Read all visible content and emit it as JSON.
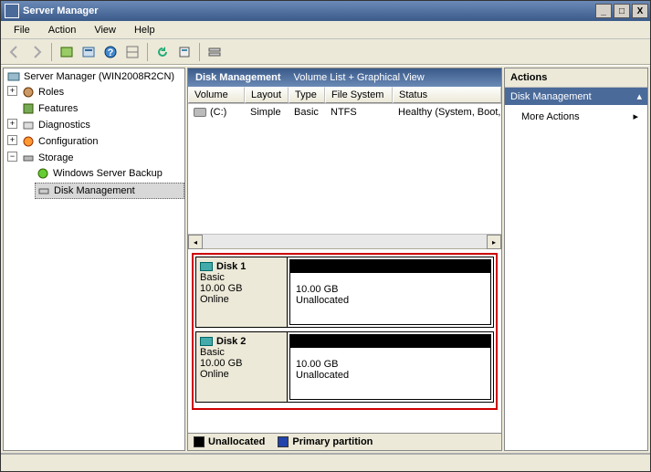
{
  "window": {
    "title": "Server Manager"
  },
  "menu": {
    "file": "File",
    "action": "Action",
    "view": "View",
    "help": "Help"
  },
  "tree": {
    "root": "Server Manager (WIN2008R2CN)",
    "roles": "Roles",
    "features": "Features",
    "diagnostics": "Diagnostics",
    "configuration": "Configuration",
    "storage": "Storage",
    "wsb": "Windows Server Backup",
    "diskmgmt": "Disk Management"
  },
  "center": {
    "title": "Disk Management",
    "subtitle": "Volume List + Graphical View",
    "cols": {
      "volume": "Volume",
      "layout": "Layout",
      "type": "Type",
      "fs": "File System",
      "status": "Status"
    },
    "row1": {
      "volume": "(C:)",
      "layout": "Simple",
      "type": "Basic",
      "fs": "NTFS",
      "status": "Healthy (System, Boot, Pa"
    }
  },
  "disks": [
    {
      "name": "Disk 1",
      "kind": "Basic",
      "size": "10.00 GB",
      "state": "Online",
      "part_size": "10.00 GB",
      "part_label": "Unallocated"
    },
    {
      "name": "Disk 2",
      "kind": "Basic",
      "size": "10.00 GB",
      "state": "Online",
      "part_size": "10.00 GB",
      "part_label": "Unallocated"
    }
  ],
  "legend": {
    "unalloc": "Unallocated",
    "primary": "Primary partition"
  },
  "actions": {
    "title": "Actions",
    "section": "Disk Management",
    "more": "More Actions"
  }
}
